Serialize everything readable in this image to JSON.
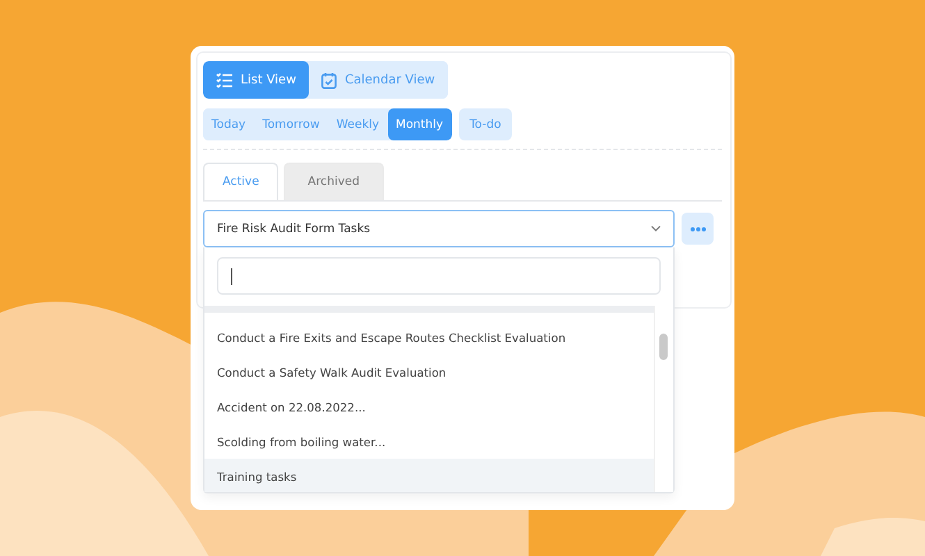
{
  "view_toggle": [
    {
      "label": "List View",
      "selected": true
    },
    {
      "label": "Calendar View",
      "selected": false
    }
  ],
  "period_filters": [
    {
      "label": "Today",
      "selected": false
    },
    {
      "label": "Tomorrow",
      "selected": false
    },
    {
      "label": "Weekly",
      "selected": false
    },
    {
      "label": "Monthly",
      "selected": true
    }
  ],
  "todo_button": {
    "label": "To-do"
  },
  "tabs": [
    {
      "label": "Active",
      "selected": true
    },
    {
      "label": "Archived",
      "selected": false
    }
  ],
  "task_select": {
    "value": "Fire Risk Audit Form Tasks",
    "expanded": true,
    "options": [
      {
        "label": "Conduct a Fire Exits and Escape Routes Checklist Evaluation",
        "highlighted": false
      },
      {
        "label": "Conduct a Safety Walk Audit Evaluation",
        "highlighted": false
      },
      {
        "label": "Accident on 22.08.2022...",
        "highlighted": false
      },
      {
        "label": "Scolding from boiling water...",
        "highlighted": false
      },
      {
        "label": "Training tasks",
        "highlighted": true
      }
    ]
  }
}
